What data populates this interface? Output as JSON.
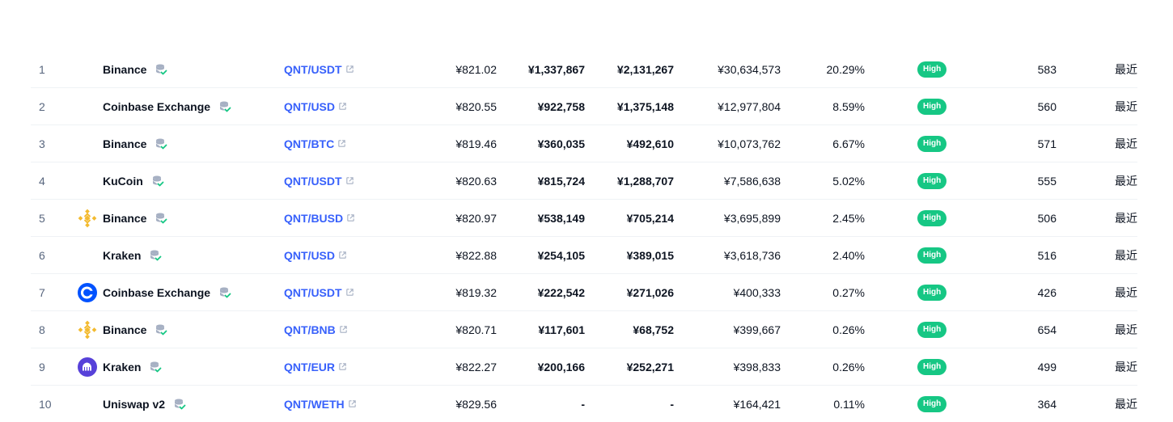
{
  "colors": {
    "link": "#3861fb",
    "badge": "#16c784",
    "verify_green": "#16c784",
    "verify_gray": "#a6b0c3"
  },
  "rows": [
    {
      "rank": "1",
      "logo": "",
      "exchange": "Binance",
      "pair": "QNT/USDT",
      "price": "¥821.02",
      "depth_plus": "¥1,337,867",
      "depth_minus": "¥2,131,267",
      "volume": "¥30,634,573",
      "share": "20.29%",
      "confidence": "High",
      "liquidity": "583",
      "updated": "最近"
    },
    {
      "rank": "2",
      "logo": "",
      "exchange": "Coinbase Exchange",
      "pair": "QNT/USD",
      "price": "¥820.55",
      "depth_plus": "¥922,758",
      "depth_minus": "¥1,375,148",
      "volume": "¥12,977,804",
      "share": "8.59%",
      "confidence": "High",
      "liquidity": "560",
      "updated": "最近"
    },
    {
      "rank": "3",
      "logo": "",
      "exchange": "Binance",
      "pair": "QNT/BTC",
      "price": "¥819.46",
      "depth_plus": "¥360,035",
      "depth_minus": "¥492,610",
      "volume": "¥10,073,762",
      "share": "6.67%",
      "confidence": "High",
      "liquidity": "571",
      "updated": "最近"
    },
    {
      "rank": "4",
      "logo": "",
      "exchange": "KuCoin",
      "pair": "QNT/USDT",
      "price": "¥820.63",
      "depth_plus": "¥815,724",
      "depth_minus": "¥1,288,707",
      "volume": "¥7,586,638",
      "share": "5.02%",
      "confidence": "High",
      "liquidity": "555",
      "updated": "最近"
    },
    {
      "rank": "5",
      "logo": "binance-logo-icon",
      "exchange": "Binance",
      "pair": "QNT/BUSD",
      "price": "¥820.97",
      "depth_plus": "¥538,149",
      "depth_minus": "¥705,214",
      "volume": "¥3,695,899",
      "share": "2.45%",
      "confidence": "High",
      "liquidity": "506",
      "updated": "最近"
    },
    {
      "rank": "6",
      "logo": "",
      "exchange": "Kraken",
      "pair": "QNT/USD",
      "price": "¥822.88",
      "depth_plus": "¥254,105",
      "depth_minus": "¥389,015",
      "volume": "¥3,618,736",
      "share": "2.40%",
      "confidence": "High",
      "liquidity": "516",
      "updated": "最近"
    },
    {
      "rank": "7",
      "logo": "coinbase-logo-icon",
      "exchange": "Coinbase Exchange",
      "pair": "QNT/USDT",
      "price": "¥819.32",
      "depth_plus": "¥222,542",
      "depth_minus": "¥271,026",
      "volume": "¥400,333",
      "share": "0.27%",
      "confidence": "High",
      "liquidity": "426",
      "updated": "最近"
    },
    {
      "rank": "8",
      "logo": "binance-logo-icon",
      "exchange": "Binance",
      "pair": "QNT/BNB",
      "price": "¥820.71",
      "depth_plus": "¥117,601",
      "depth_minus": "¥68,752",
      "volume": "¥399,667",
      "share": "0.26%",
      "confidence": "High",
      "liquidity": "654",
      "updated": "最近"
    },
    {
      "rank": "9",
      "logo": "kraken-logo-icon",
      "exchange": "Kraken",
      "pair": "QNT/EUR",
      "price": "¥822.27",
      "depth_plus": "¥200,166",
      "depth_minus": "¥252,271",
      "volume": "¥398,833",
      "share": "0.26%",
      "confidence": "High",
      "liquidity": "499",
      "updated": "最近"
    },
    {
      "rank": "10",
      "logo": "",
      "exchange": "Uniswap v2",
      "pair": "QNT/WETH",
      "price": "¥829.56",
      "depth_plus": "-",
      "depth_minus": "-",
      "volume": "¥164,421",
      "share": "0.11%",
      "confidence": "High",
      "liquidity": "364",
      "updated": "最近"
    }
  ]
}
